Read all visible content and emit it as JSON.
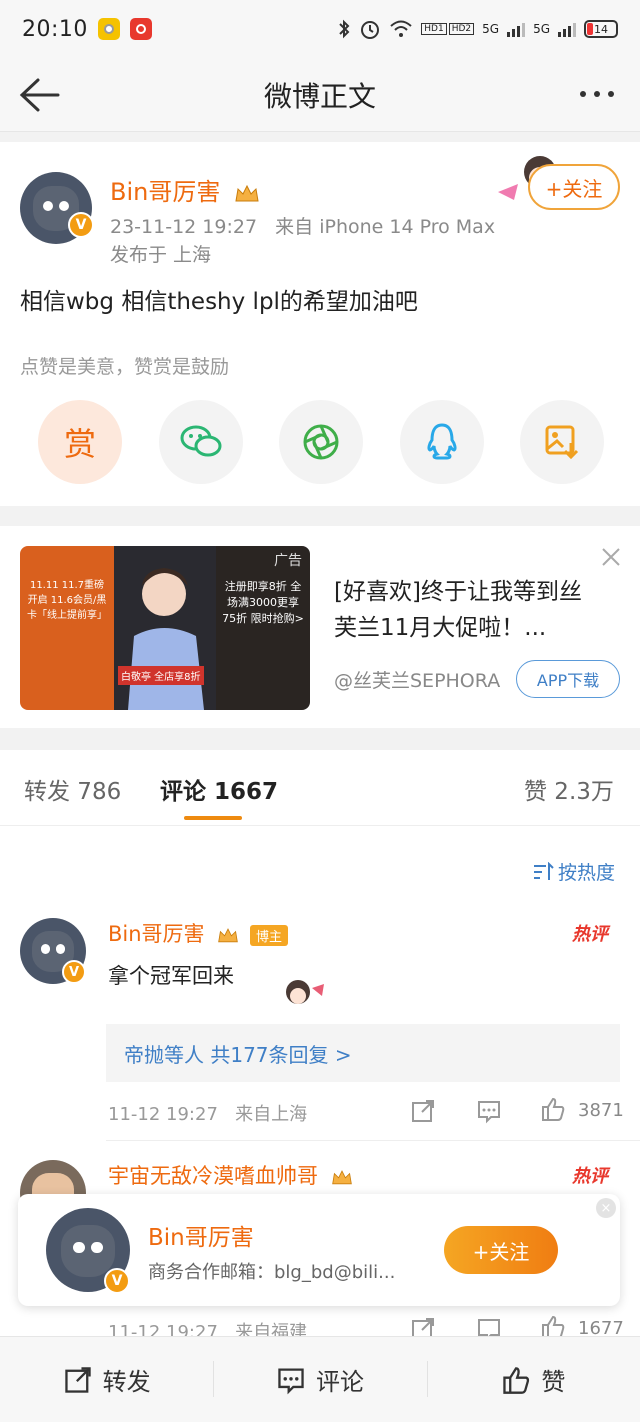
{
  "status_bar": {
    "time": "20:10",
    "network_labels": [
      "HD1",
      "HD2",
      "5G",
      "5G"
    ],
    "battery": "14"
  },
  "nav": {
    "title": "微博正文"
  },
  "post": {
    "author": "Bin哥厉害",
    "verified_mark": "V",
    "timestamp": "23-11-12 19:27",
    "source": "来自 iPhone 14 Pro Max",
    "location": "发布于 上海",
    "follow_label": "+关注",
    "text": "相信wbg 相信theshy lpl的希望加油吧",
    "reward_hint": "点赞是美意，赞赏是鼓励",
    "reward_label": "赏",
    "share_targets": [
      "wechat-icon",
      "moments-icon",
      "qq-icon",
      "save-image-icon"
    ]
  },
  "ad": {
    "tag": "广告",
    "panel1_text": "11.11 11.7重磅开启 11.6会员/黑卡「线上提前享」",
    "panel2_text": "白敬亭 全店享8折",
    "panel3_text": "注册即享8折 全场满3000更享75折 限时抢购>",
    "text": "[好喜欢]终于让我等到丝芙兰11月大促啦！...",
    "source": "@丝芙兰SEPHORA",
    "button": "APP下载"
  },
  "tabs": {
    "repost": "转发 786",
    "comments": "评论 1667",
    "likes": "赞 2.3万"
  },
  "sort_label": "按热度",
  "comments": [
    {
      "author": "Bin哥厉害",
      "badge": "博主",
      "hot": "热评",
      "text": "拿个冠军回来",
      "replies": "帝抛等人 共177条回复 >",
      "time": "11-12 19:27",
      "location": "来自上海",
      "likes": "3871"
    },
    {
      "author": "宇宙无敌冷漠嗜血帅哥",
      "hot": "热评",
      "time": "11-12 19:27",
      "location": "来自福建",
      "likes": "1677"
    }
  ],
  "follow_card": {
    "name": "Bin哥厉害",
    "desc": "商务合作邮箱：blg_bd@bili...",
    "button": "+关注",
    "close": "×"
  },
  "bottom_bar": {
    "repost": "转发",
    "comment": "评论",
    "like": "赞"
  },
  "colors": {
    "accent_orange": "#ee6a0f",
    "link_blue": "#3f7fc6",
    "hot_red": "#e8382d"
  }
}
